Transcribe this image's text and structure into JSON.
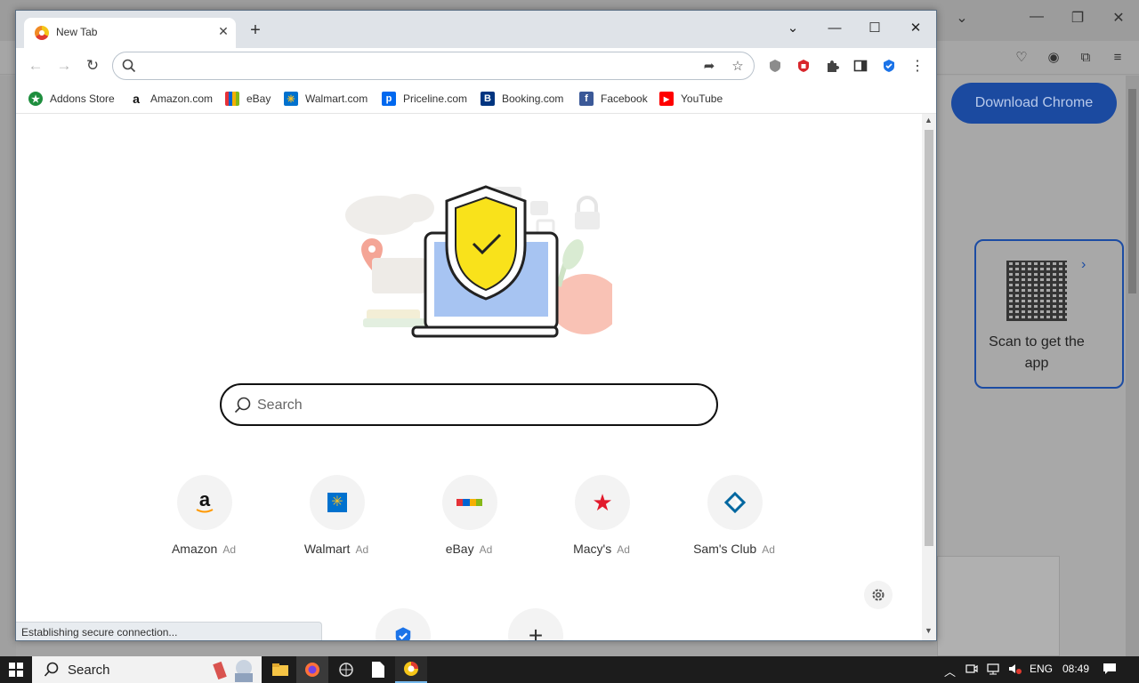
{
  "background_browser": {
    "download_button": "Download Chrome",
    "qr_text": "Scan to get the app"
  },
  "tab": {
    "title": "New Tab"
  },
  "omnibox": {
    "value": "",
    "placeholder": ""
  },
  "bookmarks": [
    {
      "label": "Addons Store",
      "icon": "addons-store-icon",
      "color": "#1e8e3e"
    },
    {
      "label": "Amazon.com",
      "icon": "amazon-icon",
      "color": "#ffffff"
    },
    {
      "label": "eBay",
      "icon": "ebay-icon",
      "color": "#e53238"
    },
    {
      "label": "Walmart.com",
      "icon": "walmart-icon",
      "color": "#0071ce"
    },
    {
      "label": "Priceline.com",
      "icon": "priceline-icon",
      "color": "#0068ef"
    },
    {
      "label": "Booking.com",
      "icon": "booking-icon",
      "color": "#003580"
    },
    {
      "label": "Facebook",
      "icon": "facebook-icon",
      "color": "#3b5998"
    },
    {
      "label": "YouTube",
      "icon": "youtube-icon",
      "color": "#ff0000"
    }
  ],
  "search": {
    "placeholder": "Search"
  },
  "tiles": [
    {
      "label": "Amazon",
      "ad": "Ad",
      "icon": "amazon-logo-icon"
    },
    {
      "label": "Walmart",
      "ad": "Ad",
      "icon": "walmart-logo-icon"
    },
    {
      "label": "eBay",
      "ad": "Ad",
      "icon": "ebay-logo-icon"
    },
    {
      "label": "Macy's",
      "ad": "Ad",
      "icon": "macys-star-icon"
    },
    {
      "label": "Sam's Club",
      "ad": "Ad",
      "icon": "sams-club-icon"
    }
  ],
  "extra_tiles": [
    {
      "icon": "shield-check-icon"
    },
    {
      "icon": "plus-icon"
    }
  ],
  "status_bar": "Establishing secure connection...",
  "taskbar": {
    "search_label": "Search",
    "language": "ENG",
    "time": "08:49"
  },
  "colors": {
    "accent_blue": "#1b73e8",
    "shield_yellow": "#f9e21b",
    "macys_red": "#e21a2c",
    "sams_blue": "#0067a0",
    "download_button": "#1b4aa0"
  }
}
